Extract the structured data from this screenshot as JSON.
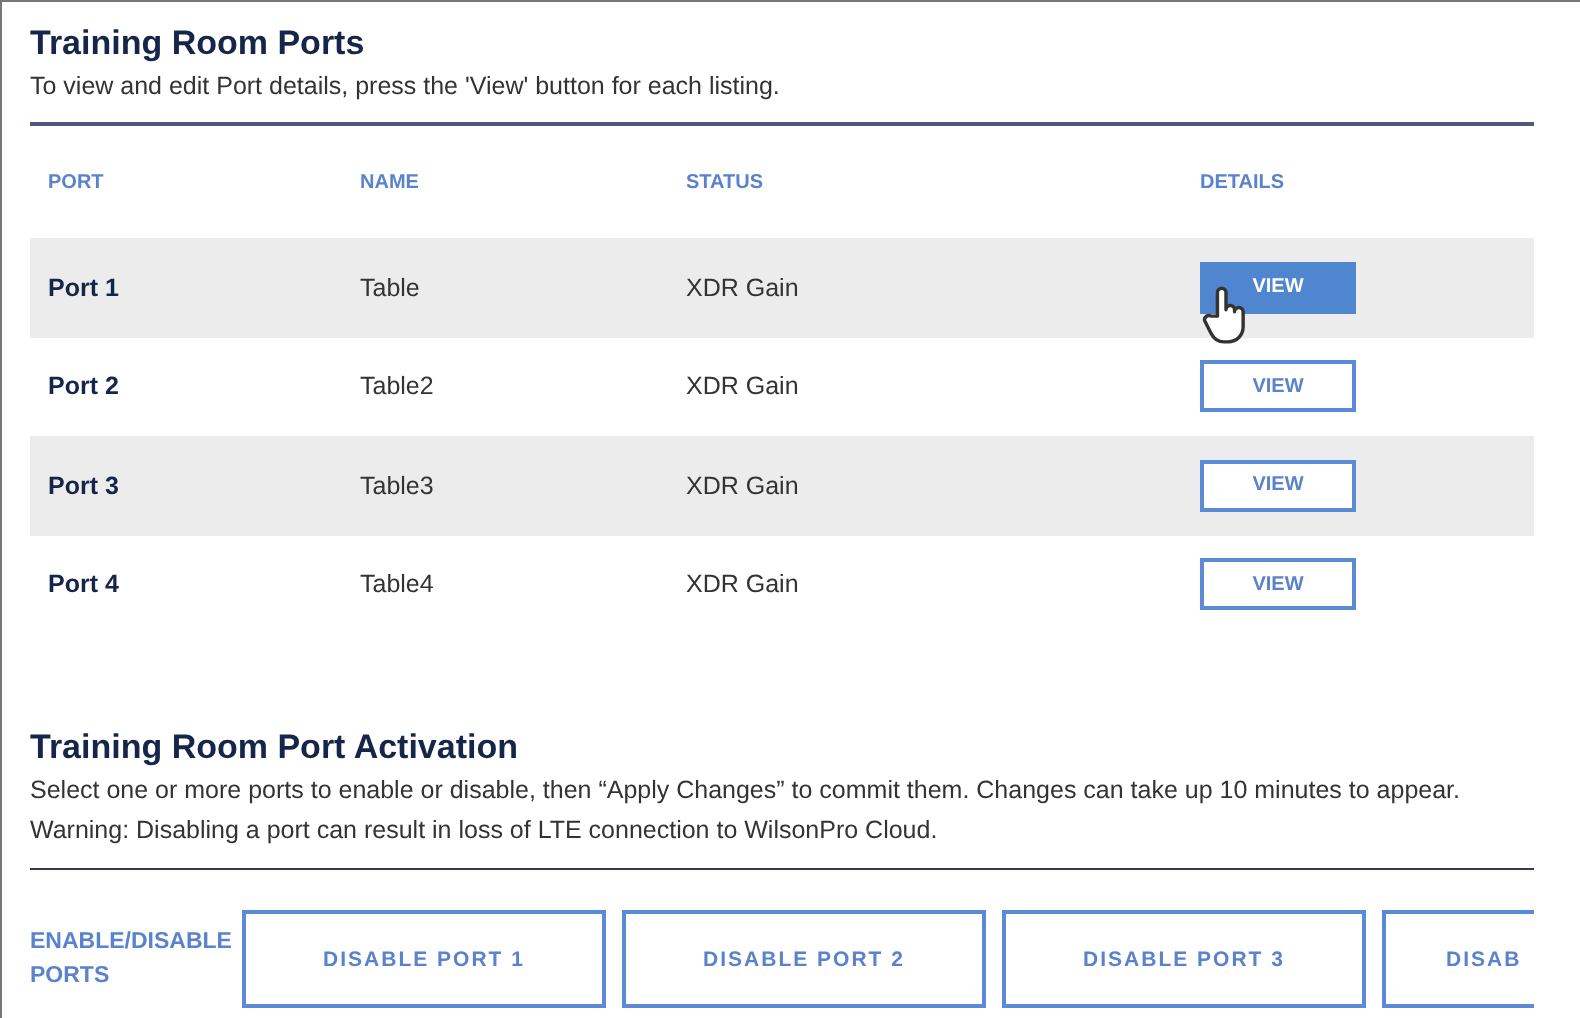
{
  "ports_section": {
    "title": "Training Room Ports",
    "description": "To view and edit Port details, press the 'View' button for each listing.",
    "table": {
      "columns": [
        "PORT",
        "NAME",
        "STATUS",
        "DETAILS"
      ],
      "rows": [
        {
          "port": "Port 1",
          "name": "Table",
          "status": "XDR Gain",
          "action": "VIEW",
          "hovered": true
        },
        {
          "port": "Port 2",
          "name": "Table2",
          "status": "XDR Gain",
          "action": "VIEW",
          "hovered": false
        },
        {
          "port": "Port 3",
          "name": "Table3",
          "status": "XDR Gain",
          "action": "VIEW",
          "hovered": false
        },
        {
          "port": "Port 4",
          "name": "Table4",
          "status": "XDR Gain",
          "action": "VIEW",
          "hovered": false
        }
      ]
    }
  },
  "activation_section": {
    "title": "Training Room Port Activation",
    "description": [
      "Select one or more ports to enable or disable, then “Apply Changes” to commit them. Changes can take up 10 minutes to appear.",
      "Warning: Disabling a port can result in loss of LTE connection to WilsonPro Cloud."
    ],
    "label": "ENABLE/DISABLE PORTS",
    "buttons": [
      "DISABLE PORT 1",
      "DISABLE PORT 2",
      "DISABLE PORT 3",
      "DISAB"
    ]
  }
}
